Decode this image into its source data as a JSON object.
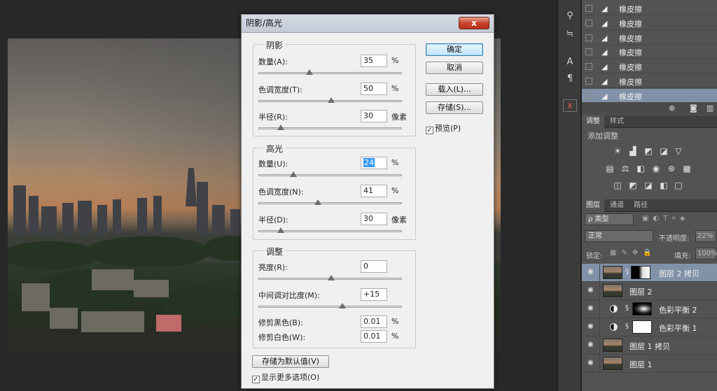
{
  "dialog": {
    "title": "阴影/高光",
    "close_label": "x",
    "shadows": {
      "title": "阴影",
      "amount": {
        "label": "数量(A):",
        "value": "35",
        "unit": "%",
        "slider": 0.35
      },
      "tonal_width": {
        "label": "色调宽度(T):",
        "value": "50",
        "unit": "%",
        "slider": 0.5
      },
      "radius": {
        "label": "半径(R):",
        "value": "30",
        "unit": "像素",
        "slider": 0.15
      }
    },
    "highlights": {
      "title": "高光",
      "amount": {
        "label": "数量(U):",
        "value": "24",
        "unit": "%",
        "slider": 0.24
      },
      "tonal_width": {
        "label": "色调宽度(N):",
        "value": "41",
        "unit": "%",
        "slider": 0.41
      },
      "radius": {
        "label": "半径(D):",
        "value": "30",
        "unit": "像素",
        "slider": 0.15
      }
    },
    "adjustments": {
      "title": "调整",
      "brightness": {
        "label": "亮度(R):",
        "value": "0",
        "slider": 0.5
      },
      "midtone_contrast": {
        "label": "中间调对比度(M):",
        "value": "+15",
        "slider": 0.58
      },
      "clip_black": {
        "label": "修剪黑色(B):",
        "value": "0.01",
        "unit": "%"
      },
      "clip_white": {
        "label": "修剪白色(W):",
        "value": "0.01",
        "unit": "%"
      }
    },
    "buttons": {
      "ok": "确定",
      "cancel": "取消",
      "load": "载入(L)...",
      "save": "存储(S)...",
      "save_default": "存储为默认值(V)"
    },
    "preview": {
      "label": "预览(P)",
      "checked": true
    },
    "show_more": {
      "label": "显示更多选项(O)",
      "checked": true
    }
  },
  "history": {
    "items": [
      "橡皮擦",
      "橡皮擦",
      "橡皮擦",
      "橡皮擦",
      "橡皮擦",
      "橡皮擦",
      "橡皮擦"
    ],
    "active_index": 6
  },
  "adjustments_panel": {
    "tabs": [
      "调整",
      "样式"
    ],
    "title": "添加调整"
  },
  "layers_panel": {
    "tabs": [
      "图层",
      "通道",
      "路径"
    ],
    "filter_label": "ρ 类型",
    "blend_mode": "正常",
    "opacity_label": "不透明度:",
    "opacity_value": "22%",
    "lock_label": "锁定:",
    "fill_label": "填充:",
    "fill_value": "100%",
    "layers": [
      {
        "name": "图层 2 拷贝",
        "active": true
      },
      {
        "name": "图层 2",
        "active": false
      },
      {
        "name": "色彩平衡 2",
        "active": false
      },
      {
        "name": "色彩平衡 1",
        "active": false
      },
      {
        "name": "图层 1 拷贝",
        "active": false
      },
      {
        "name": "图层 1",
        "active": false
      }
    ]
  },
  "colors": {
    "accent": "#8192a8",
    "panel": "#535353",
    "close": "#c8442b"
  }
}
